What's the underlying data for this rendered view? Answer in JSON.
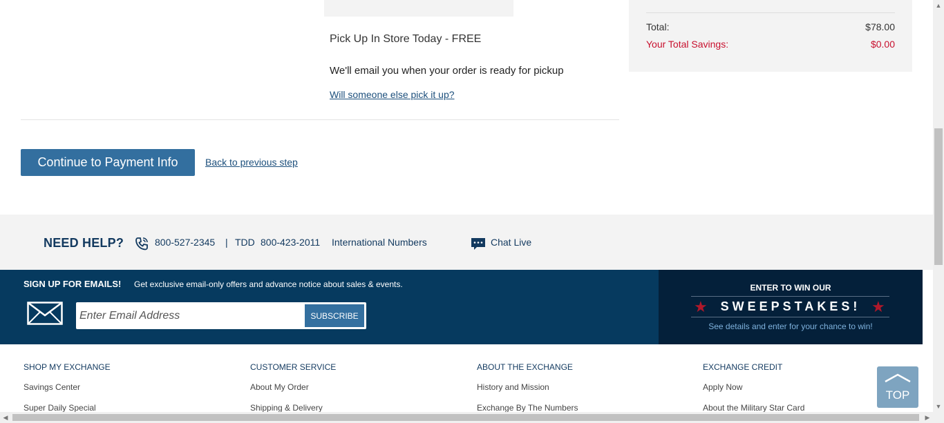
{
  "pickup": {
    "title": "Pick Up In Store Today - FREE",
    "note": "We'll email you when your order is ready for pickup",
    "link": "Will someone else pick it up?"
  },
  "summary": {
    "total_label": "Total:",
    "total_value": "$78.00",
    "savings_label": "Your Total Savings:",
    "savings_value": "$0.00"
  },
  "actions": {
    "continue_label": "Continue to Payment Info",
    "back_label": "Back to previous step"
  },
  "help": {
    "title": "NEED HELP?",
    "phone": "800-527-2345",
    "separator": "|",
    "tdd_label": "TDD",
    "tdd_phone": "800-423-2011",
    "international": "International Numbers",
    "chat": "Chat Live"
  },
  "email_signup": {
    "title": "SIGN UP FOR EMAILS!",
    "description": "Get exclusive email-only offers and advance notice about sales & events.",
    "placeholder": "Enter Email Address",
    "subscribe_label": "SUBSCRIBE"
  },
  "sweepstakes": {
    "top": "ENTER TO WIN OUR",
    "main": "SWEEPSTAKES!",
    "sub": "See details and enter for your chance to win!"
  },
  "footer": {
    "columns": [
      {
        "heading": "SHOP MY EXCHANGE",
        "links": [
          "Savings Center",
          "Super Daily Special"
        ]
      },
      {
        "heading": "CUSTOMER SERVICE",
        "links": [
          "About My Order",
          "Shipping & Delivery"
        ]
      },
      {
        "heading": "ABOUT THE EXCHANGE",
        "links": [
          "History and Mission",
          "Exchange By The Numbers"
        ]
      },
      {
        "heading": "EXCHANGE CREDIT",
        "links": [
          "Apply Now",
          "About the Military Star Card"
        ]
      }
    ]
  },
  "top_button": {
    "label": "TOP"
  },
  "colors": {
    "primary_button": "#336f9f",
    "navy": "#063a5f",
    "dark_navy": "#04203a",
    "savings_red": "#c8102e",
    "link": "#1c4f7c"
  }
}
